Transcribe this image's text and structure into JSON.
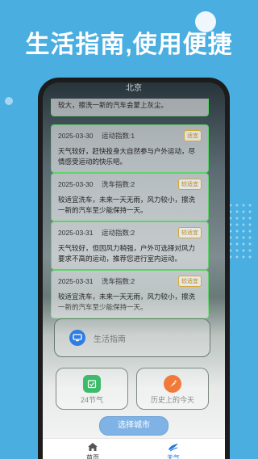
{
  "promo": {
    "title": "生活指南,使用便捷"
  },
  "phone": {
    "top_title": "北京",
    "partial_card_text": "较大，擦洗一新的汽车会蒙上灰尘。",
    "cards": [
      {
        "date": "2025-03-30",
        "title": "运动指数:1",
        "tag": "适宜",
        "body": "天气较好，赶快投身大自然参与户外运动，尽情感受运动的快乐吧。"
      },
      {
        "date": "2025-03-30",
        "title": "洗车指数:2",
        "tag": "较适宜",
        "body": "较适宜洗车，未来一天无雨，风力较小，擦洗一新的汽车至少能保持一天。"
      },
      {
        "date": "2025-03-31",
        "title": "运动指数:2",
        "tag": "较适宜",
        "body": "天气较好，但因风力稍强，户外可选择对风力要求不高的运动，推荐您进行室内运动。"
      },
      {
        "date": "2025-03-31",
        "title": "洗车指数:2",
        "tag": "较适宜",
        "body": "较适宜洗车，未来一天无雨，风力较小，擦洗一新的汽车至少能保持一天。"
      }
    ],
    "guide": {
      "label": "生活指南"
    },
    "tiles": [
      {
        "label": "24节气"
      },
      {
        "label": "历史上的今天"
      }
    ],
    "select_city_button": "选择城市",
    "tabs": [
      {
        "label": "首页"
      },
      {
        "label": "天气"
      }
    ]
  },
  "colors": {
    "background": "#4aaee0",
    "card_border": "#5fd36a",
    "active_tab": "#1a7ad6",
    "button": "#7fb3e6"
  }
}
